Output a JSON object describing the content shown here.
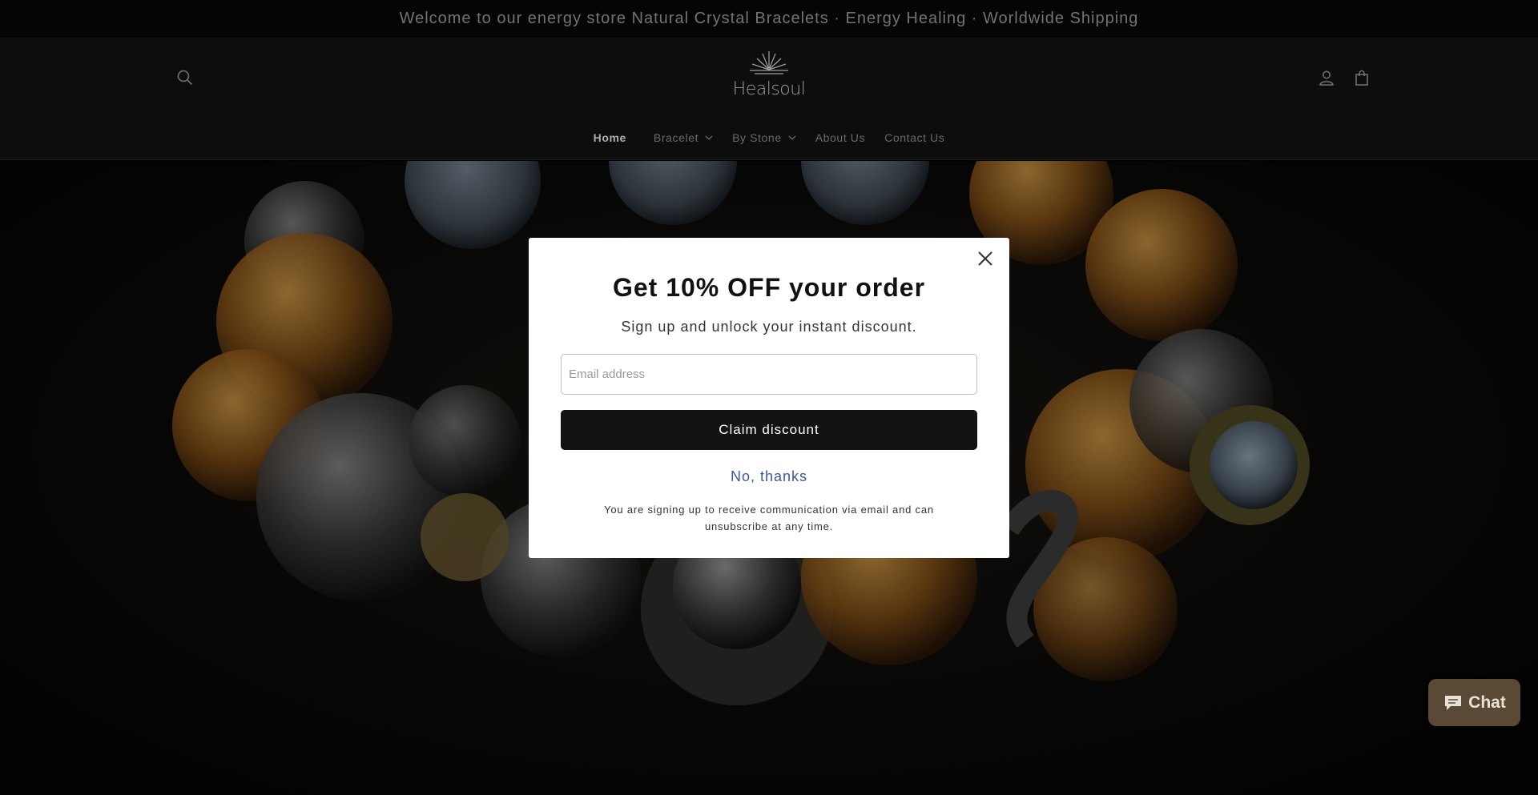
{
  "announcement": {
    "text": "Welcome to our energy store  Natural Crystal Bracelets · Energy Healing · Worldwide Shipping"
  },
  "header": {
    "logo_text": "Healsoul",
    "icons": {
      "search": "search-icon",
      "account": "user-icon",
      "cart": "cart-icon"
    }
  },
  "nav": {
    "items": [
      {
        "label": "Home",
        "active": true
      },
      {
        "label": "Bracelet",
        "dropdown": true
      },
      {
        "label": "By Stone",
        "dropdown": true
      },
      {
        "label": "About Us"
      },
      {
        "label": "Contact Us"
      }
    ]
  },
  "popup": {
    "title": "Get 10% OFF your order",
    "subtitle": "Sign up and unlock your instant discount.",
    "email_placeholder": "Email address",
    "email_value": "",
    "claim_label": "Claim discount",
    "decline_label": "No, thanks",
    "disclaimer": "You are signing up to receive communication via email and can unsubscribe at any time."
  },
  "chat": {
    "label": "Chat",
    "icon": "chat-bubble-icon"
  },
  "colors": {
    "announcement_bg": "#070707",
    "header_bg": "#121212",
    "claim_bg": "#121212",
    "decline_link": "#3b5998",
    "chat_bg": "#5a4a35"
  }
}
